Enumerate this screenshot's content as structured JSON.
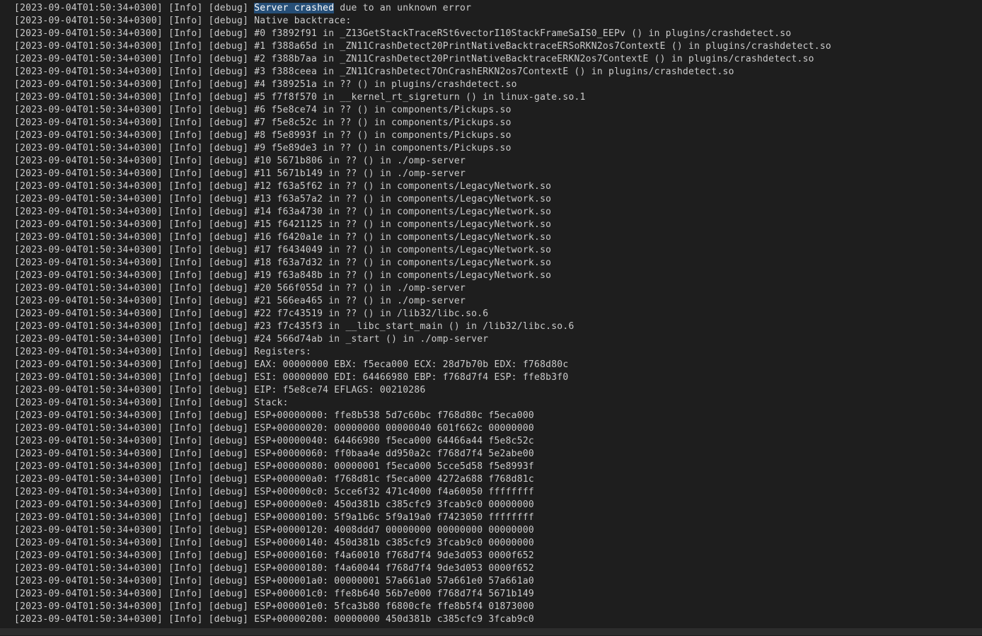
{
  "log": {
    "prefix": "[2023-09-04T01:50:34+0300] [Info] [debug] ",
    "first_line": {
      "selected": "Server crashed",
      "rest": " due to an unknown error"
    },
    "lines": [
      "Native backtrace:",
      "#0 f3892f91 in _Z13GetStackTraceRSt6vectorI10StackFrameSaIS0_EEPv () in plugins/crashdetect.so",
      "#1 f388a65d in _ZN11CrashDetect20PrintNativeBacktraceERSoRKN2os7ContextE () in plugins/crashdetect.so",
      "#2 f388b7aa in _ZN11CrashDetect20PrintNativeBacktraceERKN2os7ContextE () in plugins/crashdetect.so",
      "#3 f388ceea in _ZN11CrashDetect7OnCrashERKN2os7ContextE () in plugins/crashdetect.so",
      "#4 f389251a in ?? () in plugins/crashdetect.so",
      "#5 f7f8f570 in __kernel_rt_sigreturn () in linux-gate.so.1",
      "#6 f5e8ce74 in ?? () in components/Pickups.so",
      "#7 f5e8c52c in ?? () in components/Pickups.so",
      "#8 f5e8993f in ?? () in components/Pickups.so",
      "#9 f5e89de3 in ?? () in components/Pickups.so",
      "#10 5671b806 in ?? () in ./omp-server",
      "#11 5671b149 in ?? () in ./omp-server",
      "#12 f63a5f62 in ?? () in components/LegacyNetwork.so",
      "#13 f63a57a2 in ?? () in components/LegacyNetwork.so",
      "#14 f63a4730 in ?? () in components/LegacyNetwork.so",
      "#15 f6421125 in ?? () in components/LegacyNetwork.so",
      "#16 f6420a1e in ?? () in components/LegacyNetwork.so",
      "#17 f6434049 in ?? () in components/LegacyNetwork.so",
      "#18 f63a7d32 in ?? () in components/LegacyNetwork.so",
      "#19 f63a848b in ?? () in components/LegacyNetwork.so",
      "#20 566f055d in ?? () in ./omp-server",
      "#21 566ea465 in ?? () in ./omp-server",
      "#22 f7c43519 in ?? () in /lib32/libc.so.6",
      "#23 f7c435f3 in __libc_start_main () in /lib32/libc.so.6",
      "#24 566d74ab in _start () in ./omp-server",
      "Registers:",
      "EAX: 00000000 EBX: f5eca000 ECX: 28d7b70b EDX: f768d80c",
      "ESI: 00000000 EDI: 64466980 EBP: f768d7f4 ESP: ffe8b3f0",
      "EIP: f5e8ce74 EFLAGS: 00210286",
      "Stack:",
      "ESP+00000000: ffe8b538 5d7c60bc f768d80c f5eca000",
      "ESP+00000020: 00000000 00000040 601f662c 00000000",
      "ESP+00000040: 64466980 f5eca000 64466a44 f5e8c52c",
      "ESP+00000060: ff0baa4e dd950a2c f768d7f4 5e2abe00",
      "ESP+00000080: 00000001 f5eca000 5cce5d58 f5e8993f",
      "ESP+000000a0: f768d81c f5eca000 4272a688 f768d81c",
      "ESP+000000c0: 5cce6f32 471c4000 f4a60050 ffffffff",
      "ESP+000000e0: 450d381b c385cfc9 3fcab9c0 00000000",
      "ESP+00000100: 5f9a1b6c 5f9a19a0 f7423050 ffffffff",
      "ESP+00000120: 4008ddd7 00000000 00000000 00000000",
      "ESP+00000140: 450d381b c385cfc9 3fcab9c0 00000000",
      "ESP+00000160: f4a60010 f768d7f4 9de3d053 0000f652",
      "ESP+00000180: f4a60044 f768d7f4 9de3d053 0000f652",
      "ESP+000001a0: 00000001 57a661a0 57a661e0 57a661a0",
      "ESP+000001c0: ffe8b640 56b7e000 f768d7f4 5671b149",
      "ESP+000001e0: 5fca3b80 f6800cfe ffe8b5f4 01873000",
      "ESP+00000200: 00000000 450d381b c385cfc9 3fcab9c0"
    ]
  }
}
